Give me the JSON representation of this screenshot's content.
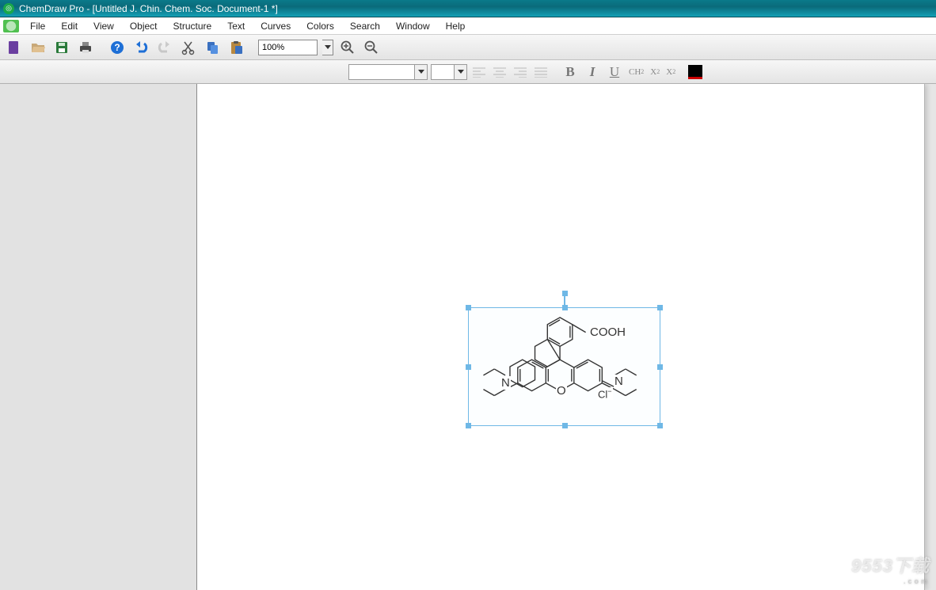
{
  "titlebar": {
    "text": "ChemDraw Pro - [Untitled J. Chin. Chem. Soc. Document-1 *]"
  },
  "menu": {
    "file": "File",
    "edit": "Edit",
    "view": "View",
    "object": "Object",
    "structure": "Structure",
    "text": "Text",
    "curves": "Curves",
    "colors": "Colors",
    "search": "Search",
    "window": "Window",
    "help": "Help"
  },
  "toolbar": {
    "zoom": "100%"
  },
  "format": {
    "font": "",
    "size": "",
    "bold": "B",
    "italic": "I",
    "underline": "U",
    "formula": "CH",
    "sub": "X",
    "sup": "X"
  },
  "structure": {
    "cooh": "COOH",
    "n_left": "N",
    "o_center": "O",
    "n_right": "N",
    "cl": "Cl"
  },
  "watermark": {
    "main": "9553下载",
    "sub": ".com"
  }
}
